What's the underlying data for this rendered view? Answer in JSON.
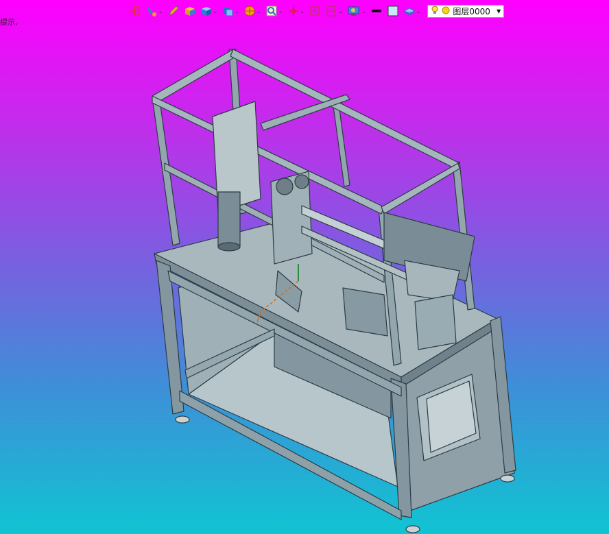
{
  "status": {
    "hint": "提示,"
  },
  "layer": {
    "name": "图层0000",
    "dropdown_arrow": "▼"
  },
  "colors": {
    "background_top": "#ff00ff",
    "background_bottom": "#10c4d2",
    "frame": "#8fa3ad",
    "frame_edge": "#2b3b44",
    "panel": "#a9b8bd"
  },
  "toolbar": {
    "icons": [
      "exit-icon",
      "select-tool-icon",
      "pencil-icon",
      "box-icon",
      "solid-icon",
      "view-cube-icon",
      "color-wheel-icon",
      "zoom-icon",
      "move-axis-icon",
      "fit-view-icon",
      "section-icon",
      "display-icon",
      "line-style-icon",
      "fill-color-icon",
      "layer-icon",
      "lightbulb-icon",
      "sun-icon"
    ]
  }
}
